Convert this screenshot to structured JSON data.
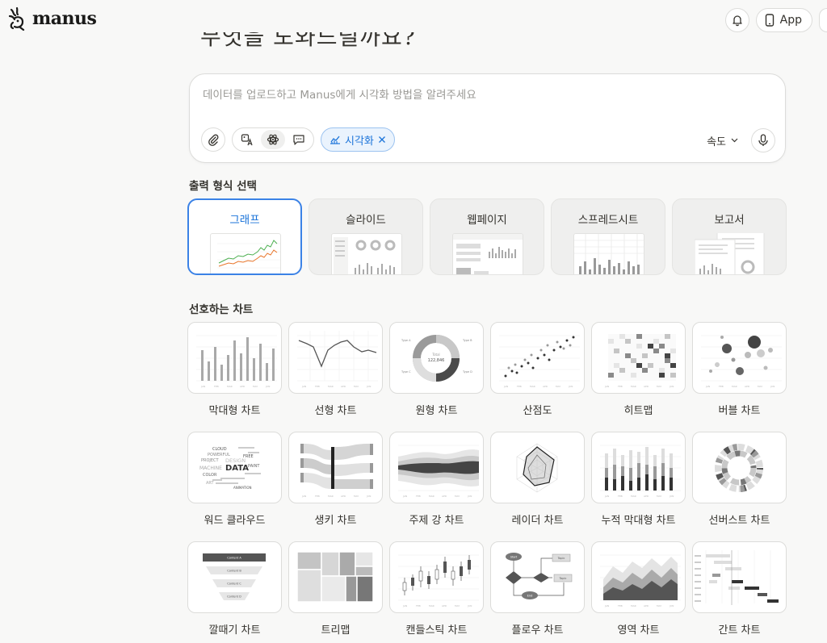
{
  "brand": {
    "name": "manus"
  },
  "topbar": {
    "app_label": "App"
  },
  "heading": {
    "text": "무엇을 도와드릴까요?"
  },
  "composer": {
    "placeholder": "데이터를 업로드하고 Manus에게 시각화 방법을 알려주세요",
    "chip_label": "시각화",
    "speed_label": "속도"
  },
  "formats": {
    "title": "출력 형식 선택",
    "items": [
      {
        "label": "그래프",
        "selected": true
      },
      {
        "label": "슬라이드",
        "selected": false
      },
      {
        "label": "웹페이지",
        "selected": false
      },
      {
        "label": "스프레드시트",
        "selected": false
      },
      {
        "label": "보고서",
        "selected": false
      }
    ]
  },
  "charts": {
    "title": "선호하는 차트",
    "items": [
      {
        "label": "막대형 차트",
        "icon": "bar-chart-icon"
      },
      {
        "label": "선형 차트",
        "icon": "line-chart-icon"
      },
      {
        "label": "원형 차트",
        "icon": "donut-chart-icon"
      },
      {
        "label": "산점도",
        "icon": "scatter-chart-icon"
      },
      {
        "label": "히트맵",
        "icon": "heatmap-icon"
      },
      {
        "label": "버블 차트",
        "icon": "bubble-chart-icon"
      },
      {
        "label": "워드 클라우드",
        "icon": "word-cloud-icon"
      },
      {
        "label": "생키 차트",
        "icon": "sankey-chart-icon"
      },
      {
        "label": "주제 강 차트",
        "icon": "theme-river-icon"
      },
      {
        "label": "레이더 차트",
        "icon": "radar-chart-icon"
      },
      {
        "label": "누적 막대형 차트",
        "icon": "stacked-bar-icon"
      },
      {
        "label": "선버스트 차트",
        "icon": "sunburst-chart-icon"
      },
      {
        "label": "깔때기 차트",
        "icon": "funnel-chart-icon"
      },
      {
        "label": "트리맵",
        "icon": "treemap-icon"
      },
      {
        "label": "캔들스틱 차트",
        "icon": "candlestick-icon"
      },
      {
        "label": "플로우 차트",
        "icon": "flow-chart-icon"
      },
      {
        "label": "영역 차트",
        "icon": "area-chart-icon"
      },
      {
        "label": "간트 차트",
        "icon": "gantt-chart-icon"
      }
    ]
  },
  "thumb_text": {
    "months": [
      "JAN",
      "FEB",
      "MAR",
      "APR",
      "MAY",
      "JUN"
    ],
    "donut": {
      "center_label": "Total",
      "center_value": "122,846",
      "labels": [
        "Type A",
        "Type B",
        "Type C",
        "Type D"
      ]
    },
    "words": [
      "CLOUD",
      "POWERFUL",
      "FREE",
      "PROJECT",
      "DESIGN",
      "MACHINE",
      "DATA",
      "PAINT",
      "COLOR",
      "ART",
      "ANIMATION"
    ],
    "funnel": [
      "Content A",
      "Content B",
      "Content C",
      "Content D"
    ],
    "flow": [
      "Start",
      "Topic",
      "End"
    ]
  },
  "colors": {
    "accent": "#1a73d9",
    "chip_bg": "#eaf3fd",
    "selected_border": "#3b82e6",
    "green_line": "#4caf50",
    "orange_line": "#e8752a"
  }
}
